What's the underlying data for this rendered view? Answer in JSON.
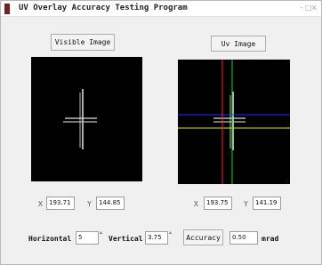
{
  "window": {
    "title": "UV Overlay Accuracy Testing Program",
    "controls": [
      "-",
      "□",
      "×"
    ]
  },
  "visible_panel": {
    "button_label": "Visible Image",
    "x_label": "X",
    "x_value": "193.71",
    "y_label": "Y",
    "y_value": "144.85"
  },
  "uv_panel": {
    "button_label": "Uv Image",
    "x_label": "X",
    "x_value": "193.75",
    "y_label": "Y",
    "y_value": "141.19",
    "crosshair_colors": {
      "vertical_red": "#ff2020",
      "vertical_green": "#20d020",
      "horizontal_blue": "#2030ff",
      "horizontal_yellow": "#e6e600"
    }
  },
  "controls": {
    "horizontal_label": "Horizontal",
    "horizontal_value": "5",
    "vertical_label": "Vertical",
    "vertical_value": "3.75",
    "accuracy_button": "Accuracy",
    "accuracy_value": "0.50",
    "unit_label": "mrad"
  }
}
